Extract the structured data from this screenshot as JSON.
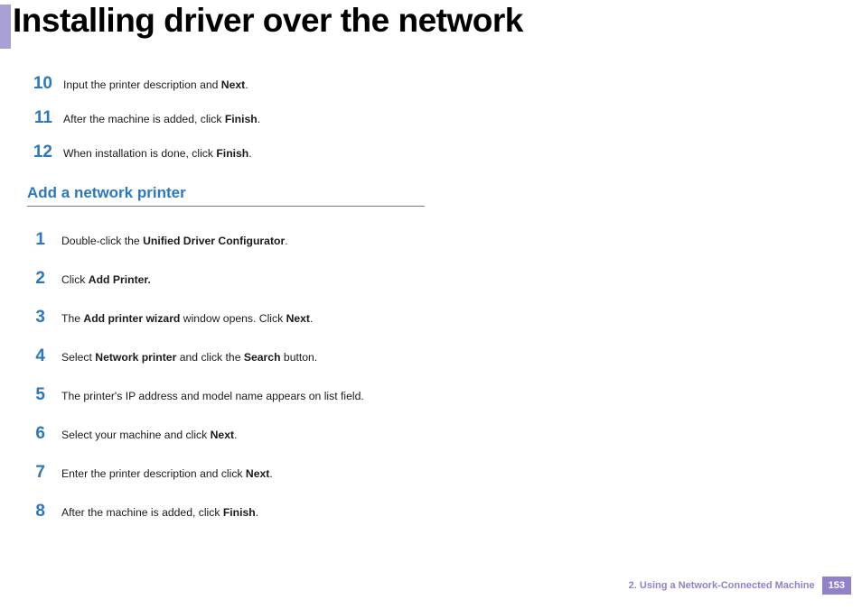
{
  "title": "Installing driver over the network",
  "top_steps": [
    {
      "num": "10",
      "segments": [
        "Input the printer description and ",
        [
          "b",
          "Next"
        ],
        "."
      ]
    },
    {
      "num": "11",
      "segments": [
        "After the machine is added, click ",
        [
          "b",
          "Finish"
        ],
        "."
      ]
    },
    {
      "num": "12",
      "segments": [
        "When installation is done, click ",
        [
          "b",
          "Finish"
        ],
        "."
      ]
    }
  ],
  "section_heading": "Add a network printer",
  "lower_steps": [
    {
      "num": "1",
      "segments": [
        "Double-click the ",
        [
          "b",
          "Unified Driver Configurator"
        ],
        "."
      ]
    },
    {
      "num": "2",
      "segments": [
        "Click ",
        [
          "b",
          "Add Printer."
        ]
      ]
    },
    {
      "num": "3",
      "segments": [
        "The ",
        [
          "b",
          "Add printer wizard"
        ],
        " window opens. Click ",
        [
          "b",
          "Next"
        ],
        "."
      ]
    },
    {
      "num": "4",
      "segments": [
        "Select ",
        [
          "b",
          "Network printer"
        ],
        " and click the ",
        [
          "b",
          "Search"
        ],
        " button."
      ]
    },
    {
      "num": "5",
      "segments": [
        "The printer's IP address and model name appears on list field."
      ]
    },
    {
      "num": "6",
      "segments": [
        "Select your machine and click ",
        [
          "b",
          "Next"
        ],
        "."
      ]
    },
    {
      "num": "7",
      "segments": [
        "Enter the printer description and click ",
        [
          "b",
          "Next"
        ],
        "."
      ]
    },
    {
      "num": "8",
      "segments": [
        "After the machine is added, click ",
        [
          "b",
          "Finish"
        ],
        "."
      ]
    }
  ],
  "footer": {
    "chapter": "2.  Using a Network-Connected Machine",
    "page": "153"
  }
}
